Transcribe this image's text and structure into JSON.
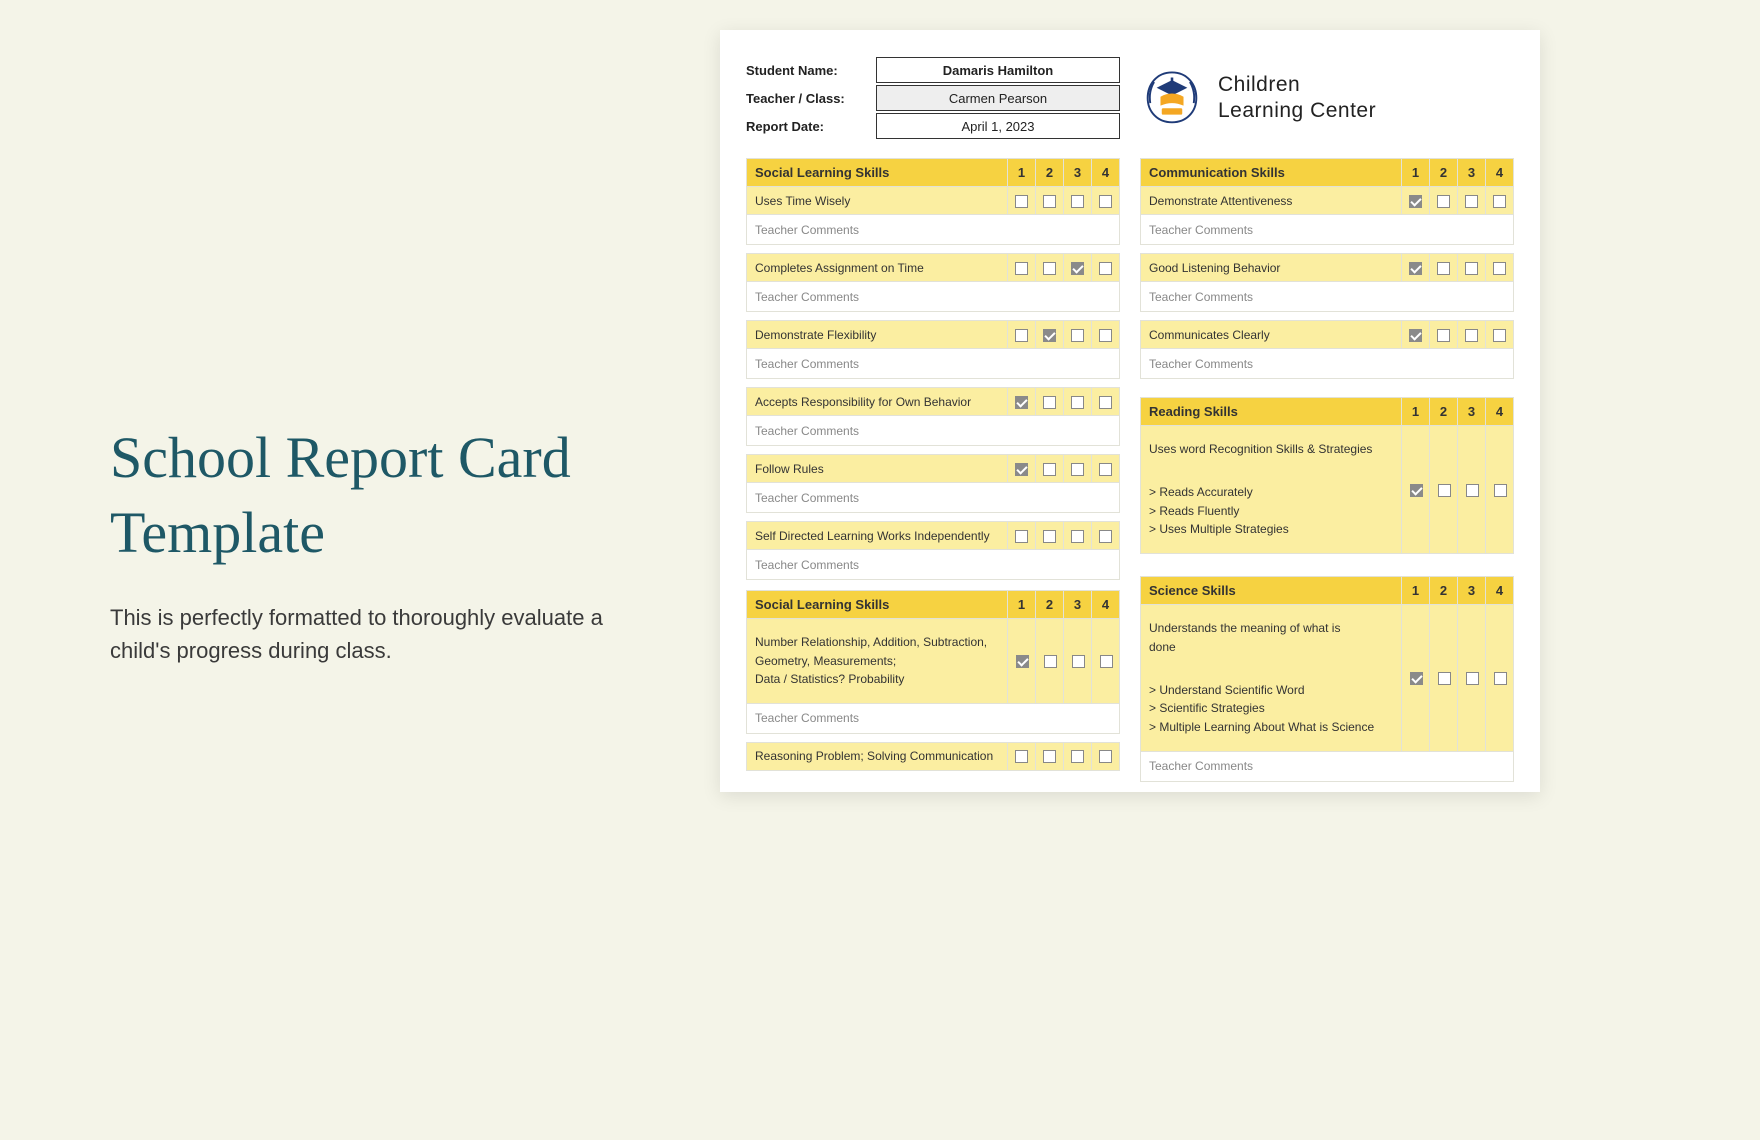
{
  "page": {
    "title": "School Report Card Template",
    "subtitle": "This is perfectly formatted to thoroughly evaluate a child's progress during class."
  },
  "labels": {
    "student_name": "Student Name:",
    "teacher_class": "Teacher / Class:",
    "report_date": "Report Date:",
    "teacher_comments": "Teacher Comments"
  },
  "student": {
    "name": "Damaris Hamilton",
    "teacher": "Carmen Pearson",
    "date": "April 1, 2023"
  },
  "school": {
    "name_line1": "Children",
    "name_line2": "Learning Center"
  },
  "cols": {
    "c1": "1",
    "c2": "2",
    "c3": "3",
    "c4": "4"
  },
  "left_sections": [
    {
      "title": "Social Learning Skills",
      "items": [
        {
          "label": "Uses Time Wisely",
          "checked": 0
        },
        {
          "label": "Completes Assignment on Time",
          "checked": 3
        },
        {
          "label": "Demonstrate Flexibility",
          "checked": 2
        },
        {
          "label": "Accepts Responsibility for Own Behavior",
          "checked": 1
        },
        {
          "label": "Follow Rules",
          "checked": 1
        },
        {
          "label": "Self Directed Learning Works Independently",
          "checked": 0
        }
      ]
    },
    {
      "title": "Social Learning Skills",
      "big_items": [
        {
          "lines": [
            "Number Relationship, Addition, Subtraction,",
            "Geometry, Measurements;",
            "Data / Statistics? Probability"
          ],
          "checked": 1
        }
      ],
      "trailing_item": {
        "label": "Reasoning Problem; Solving Communication",
        "checked": 0
      }
    }
  ],
  "right_sections": [
    {
      "title": "Communication Skills",
      "items": [
        {
          "label": "Demonstrate Attentiveness",
          "checked": 1
        },
        {
          "label": "Good Listening Behavior",
          "checked": 1
        },
        {
          "label": "Communicates Clearly",
          "checked": 1
        }
      ]
    },
    {
      "title": "Reading Skills",
      "big_items": [
        {
          "lines": [
            "Uses word Recognition Skills & Strategies",
            "",
            "> Reads Accurately",
            "> Reads Fluently",
            "> Uses Multiple Strategies"
          ],
          "checked": 1
        }
      ]
    },
    {
      "title": "Science Skills",
      "big_items": [
        {
          "lines": [
            "Understands the meaning of what is",
            "done",
            "",
            "> Understand Scientific Word",
            "> Scientific Strategies",
            "> Multiple Learning About What is Science"
          ],
          "checked": 1
        }
      ],
      "has_trailing_comments": true
    }
  ]
}
